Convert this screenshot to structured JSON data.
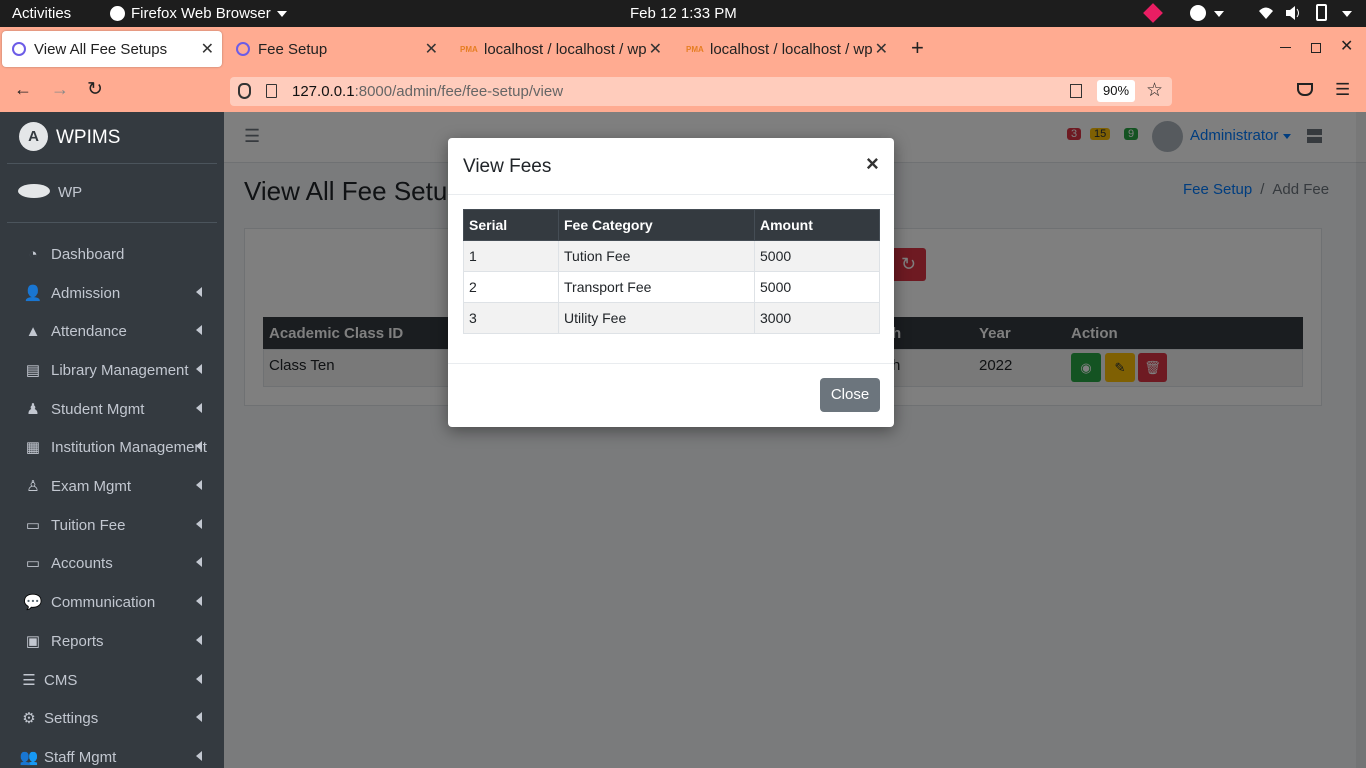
{
  "system_bar": {
    "activities": "Activities",
    "app": "Firefox Web Browser",
    "datetime": "Feb 12  1:33 PM"
  },
  "browser": {
    "tabs": [
      {
        "label": "View All Fee Setups",
        "active": true
      },
      {
        "label": "Fee Setup",
        "active": false
      },
      {
        "label": "localhost / localhost / wp",
        "active": false
      },
      {
        "label": "localhost / localhost / wp",
        "active": false
      }
    ],
    "url_host": "127.0.0.1",
    "url_path": ":8000/admin/fee/fee-setup/view",
    "zoom": "90%"
  },
  "sidebar": {
    "brand": "WPIMS",
    "user": "WP",
    "items": [
      {
        "label": "Dashboard",
        "icon": "dashboard-icon"
      },
      {
        "label": "Admission",
        "icon": "user-plus-icon"
      },
      {
        "label": "Attendance",
        "icon": "tree-icon"
      },
      {
        "label": "Library Management",
        "icon": "book-icon"
      },
      {
        "label": "Student Mgmt",
        "icon": "graduate-icon"
      },
      {
        "label": "Institution Management",
        "icon": "table-icon"
      },
      {
        "label": "Exam Mgmt",
        "icon": "chalkboard-icon"
      },
      {
        "label": "Tuition Fee",
        "icon": "money-icon"
      },
      {
        "label": "Accounts",
        "icon": "money-icon"
      },
      {
        "label": "Communication",
        "icon": "comments-icon"
      },
      {
        "label": "Reports",
        "icon": "chalkboard-icon"
      },
      {
        "label": "CMS",
        "icon": "list-icon"
      },
      {
        "label": "Settings",
        "icon": "settings-icon"
      },
      {
        "label": "Staff Mgmt",
        "icon": "users-icon"
      }
    ]
  },
  "header": {
    "badges": [
      "3",
      "15",
      "9"
    ],
    "user_name": "Administrator"
  },
  "page": {
    "title": "View All Fee Setu",
    "breadcrumb_link": "Fee Setup",
    "breadcrumb_sep": "/",
    "breadcrumb_current": "Add Fee",
    "table": {
      "headers": [
        "Academic Class ID",
        "h",
        "Year",
        "Action"
      ],
      "row": [
        "Class Ten",
        "h",
        "2022"
      ]
    }
  },
  "modal": {
    "title": "View Fees",
    "close_x": "×",
    "headers": [
      "Serial",
      "Fee Category",
      "Amount"
    ],
    "rows": [
      [
        "1",
        "Tution Fee",
        "5000"
      ],
      [
        "2",
        "Transport Fee",
        "5000"
      ],
      [
        "3",
        "Utility Fee",
        "3000"
      ]
    ],
    "close_button": "Close"
  }
}
